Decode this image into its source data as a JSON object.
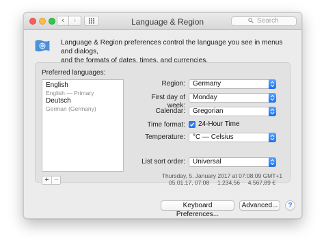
{
  "window": {
    "title": "Language & Region"
  },
  "toolbar": {
    "back": "‹",
    "forward": "›",
    "search_placeholder": "Search"
  },
  "description": [
    "Language & Region preferences control the language you see in menus and dialogs,",
    "and the formats of dates, times, and currencies."
  ],
  "preferred_languages": {
    "title": "Preferred languages:",
    "items": [
      {
        "name": "English",
        "subtitle": "English — Primary"
      },
      {
        "name": "Deutsch",
        "subtitle": "German (Germany)"
      }
    ],
    "add": "+",
    "remove": "−"
  },
  "settings": {
    "region_label": "Region:",
    "region_value": "Germany",
    "first_day_label": "First day of week:",
    "first_day_value": "Monday",
    "calendar_label": "Calendar:",
    "calendar_value": "Gregorian",
    "time_format_label": "Time format:",
    "time_format_option": "24-Hour Time",
    "time_format_checked": true,
    "temperature_label": "Temperature:",
    "temperature_value": "°C — Celsius",
    "sort_order_label": "List sort order:",
    "sort_order_value": "Universal"
  },
  "sample": {
    "line1": "Thursday, 5. January 2017 at 07:08:09 GMT+1",
    "line2": "05.01.17, 07:08     1.234,56     4.567,89 €"
  },
  "buttons": {
    "keyboard": "Keyboard Preferences...",
    "advanced": "Advanced...",
    "help": "?"
  },
  "colors": {
    "accent": "#2f7ef6",
    "window_bg": "#ececec"
  }
}
